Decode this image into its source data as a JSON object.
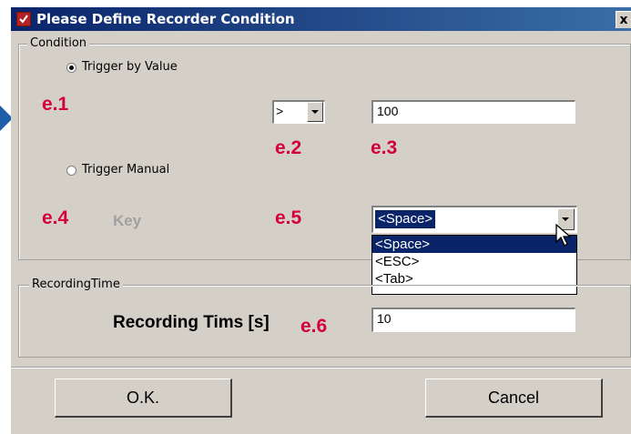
{
  "window": {
    "title": "Please Define Recorder Condition",
    "close_label": "x"
  },
  "condition": {
    "legend": "Condition",
    "trigger_value_label": "Trigger by Value",
    "trigger_manual_label": "Trigger Manual",
    "operator_value": ">",
    "threshold_value": "100",
    "key_label": "Key",
    "key_selected": "<Space>",
    "key_options": [
      "<Space>",
      "<ESC>",
      "<Tab>"
    ]
  },
  "recording": {
    "legend": "RecordingTime",
    "time_label": "Recording Tims [s]",
    "time_value": "10"
  },
  "buttons": {
    "ok": "O.K.",
    "cancel": "Cancel"
  },
  "annotations": {
    "e1": "e.1",
    "e2": "e.2",
    "e3": "e.3",
    "e4": "e.4",
    "e5": "e.5",
    "e6": "e.6"
  },
  "colors": {
    "annotation": "#d4003c",
    "titlebar": "#0a246a",
    "arrow": "#1f5fa8"
  }
}
